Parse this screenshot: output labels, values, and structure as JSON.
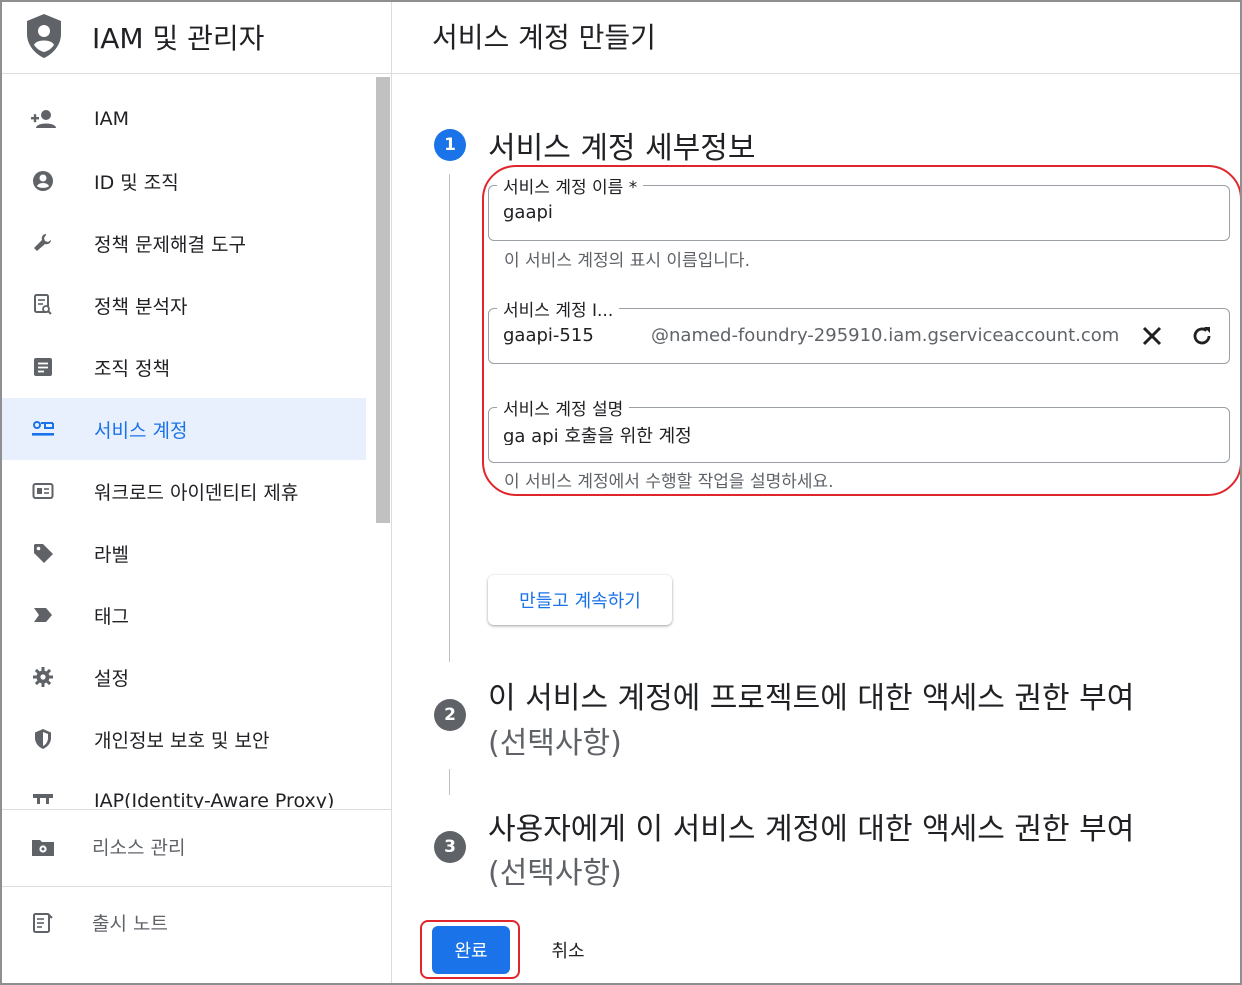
{
  "app": {
    "title": "IAM 및 관리자",
    "logo_icon": "shield-person-icon"
  },
  "sidebar": {
    "items": [
      {
        "label": "IAM",
        "icon": "person-add-icon"
      },
      {
        "label": "ID 및 조직",
        "icon": "account-circle-icon"
      },
      {
        "label": "정책 문제해결 도구",
        "icon": "wrench-icon"
      },
      {
        "label": "정책 분석자",
        "icon": "document-search-icon"
      },
      {
        "label": "조직 정책",
        "icon": "list-document-icon"
      },
      {
        "label": "서비스 계정",
        "icon": "service-account-icon",
        "active": true
      },
      {
        "label": "워크로드 아이덴티티 제휴",
        "icon": "id-card-icon"
      },
      {
        "label": "라벨",
        "icon": "tag-icon"
      },
      {
        "label": "태그",
        "icon": "label-arrow-icon"
      },
      {
        "label": "설정",
        "icon": "gear-icon"
      },
      {
        "label": "개인정보 보호 및 보안",
        "icon": "shield-icon"
      },
      {
        "label": "IAP(Identity-Aware Proxy)",
        "icon": "iap-icon"
      }
    ],
    "bottom": [
      {
        "label": "리소스 관리",
        "icon": "folder-gear-icon"
      },
      {
        "label": "출시 노트",
        "icon": "release-notes-icon"
      }
    ]
  },
  "page": {
    "title": "서비스 계정 만들기"
  },
  "steps": [
    {
      "number": "1",
      "title": "서비스 계정 세부정보",
      "subtitle": ""
    },
    {
      "number": "2",
      "title": "이 서비스 계정에 프로젝트에 대한 액세스 권한 부여",
      "subtitle": "(선택사항)"
    },
    {
      "number": "3",
      "title": "사용자에게 이 서비스 계정에 대한 액세스 권한 부여",
      "subtitle": "(선택사항)"
    }
  ],
  "form": {
    "name": {
      "label": "서비스 계정 이름 *",
      "value": "gaapi",
      "helper": "이 서비스 계정의 표시 이름입니다."
    },
    "id": {
      "label": "서비스 계정 I...",
      "value": "gaapi-515",
      "suffix": "@named-foundry-295910.iam.gserviceaccount.com"
    },
    "description": {
      "label": "서비스 계정 설명",
      "value": "ga api 호출을 위한 계정",
      "helper": "이 서비스 계정에서 수행할 작업을 설명하세요."
    }
  },
  "buttons": {
    "create_continue": "만들고 계속하기",
    "done": "완료",
    "cancel": "취소"
  },
  "colors": {
    "accent": "#1a73e8",
    "highlight": "#e0262d",
    "active_bg": "#e8f0fe"
  }
}
